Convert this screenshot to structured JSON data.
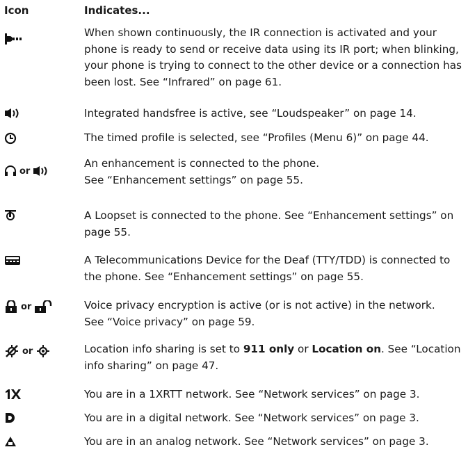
{
  "header": {
    "icon_col": "Icon",
    "indicates_col": "Indicates..."
  },
  "rows": [
    {
      "icons": [
        "ir-connection-icon"
      ],
      "text": "When shown continuously, the IR connection is activated and your phone is ready to send or receive data using its IR port; when blinking, your phone is trying to connect to the other device or a connection has been lost. See “Infrared” on page 61."
    },
    {
      "icons": [
        "integrated-handsfree-icon"
      ],
      "text": "Integrated handsfree is active, see “Loudspeaker” on page 14."
    },
    {
      "icons": [
        "timed-profile-icon"
      ],
      "text": "The timed profile is selected, see “Profiles (Menu 6)” on page 44."
    },
    {
      "icons": [
        "headset-icon",
        "loudspeaker-icon"
      ],
      "connector": "or",
      "text_line1": "An enhancement is connected to the phone.",
      "text_line2": "See “Enhancement settings” on page 55."
    },
    {
      "icons": [
        "loopset-icon"
      ],
      "text": "A Loopset is connected to the phone. See “Enhancement settings” on page 55."
    },
    {
      "icons": [
        "tty-tdd-icon"
      ],
      "text": "A Telecommunications Device for the Deaf (TTY/TDD) is connected to the phone. See “Enhancement settings” on page 55."
    },
    {
      "icons": [
        "lock-closed-icon",
        "lock-open-icon"
      ],
      "connector": "or",
      "text_line1": "Voice privacy encryption is active (or is not active) in the network.",
      "text_line2": "See “Voice privacy” on page 59."
    },
    {
      "icons": [
        "location-911-icon",
        "location-on-icon"
      ],
      "connector": "or",
      "text_pre": "Location info sharing is set to ",
      "bold1": "911 only",
      "text_mid": " or ",
      "bold2": "Location on",
      "text_post": ". See “Location info sharing” on page 47."
    },
    {
      "icons": [
        "1xrtt-network-icon"
      ],
      "text": "You are in a 1XRTT network. See “Network services” on page 3."
    },
    {
      "icons": [
        "digital-network-icon"
      ],
      "text": "You are in a digital network. See “Network services” on page 3."
    },
    {
      "icons": [
        "analog-network-icon"
      ],
      "text": "You are in an analog network. See “Network services” on page 3."
    }
  ]
}
